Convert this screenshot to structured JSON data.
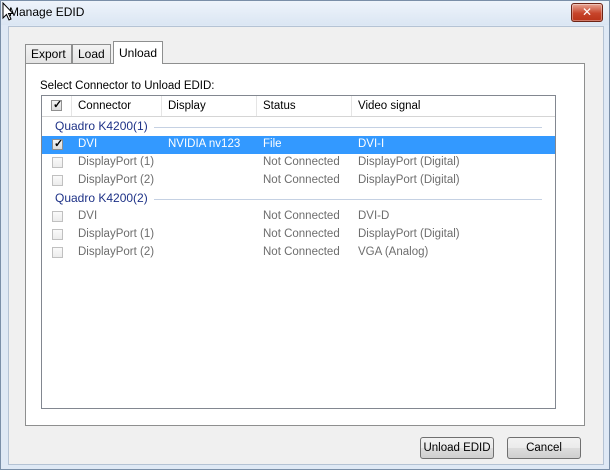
{
  "window": {
    "title": "Manage EDID",
    "close_glyph": "✕"
  },
  "tabs": [
    {
      "label": "Export"
    },
    {
      "label": "Load"
    },
    {
      "label": "Unload"
    }
  ],
  "panel": {
    "select_label": "Select Connector to Unload EDID:"
  },
  "table": {
    "columns": [
      "Connector",
      "Display",
      "Status",
      "Video signal"
    ],
    "header_checkbox_checked": true,
    "groups": [
      {
        "name": "Quadro K4200(1)",
        "rows": [
          {
            "connector": "DVI",
            "display": "NVIDIA nv123",
            "status": "File",
            "signal": "DVI-I",
            "checked": true,
            "selected": true,
            "enabled": true
          },
          {
            "connector": "DisplayPort (1)",
            "display": "",
            "status": "Not Connected",
            "signal": "DisplayPort (Digital)",
            "checked": false,
            "selected": false,
            "enabled": false
          },
          {
            "connector": "DisplayPort (2)",
            "display": "",
            "status": "Not Connected",
            "signal": "DisplayPort (Digital)",
            "checked": false,
            "selected": false,
            "enabled": false
          }
        ]
      },
      {
        "name": "Quadro K4200(2)",
        "rows": [
          {
            "connector": "DVI",
            "display": "",
            "status": "Not Connected",
            "signal": "DVI-D",
            "checked": false,
            "selected": false,
            "enabled": false
          },
          {
            "connector": "DisplayPort (1)",
            "display": "",
            "status": "Not Connected",
            "signal": "DisplayPort (Digital)",
            "checked": false,
            "selected": false,
            "enabled": false
          },
          {
            "connector": "DisplayPort (2)",
            "display": "",
            "status": "Not Connected",
            "signal": "VGA (Analog)",
            "checked": false,
            "selected": false,
            "enabled": false
          }
        ]
      }
    ]
  },
  "buttons": {
    "unload": "Unload EDID",
    "cancel": "Cancel"
  },
  "colors": {
    "selection": "#3399ff",
    "group_title": "#1e3287"
  }
}
